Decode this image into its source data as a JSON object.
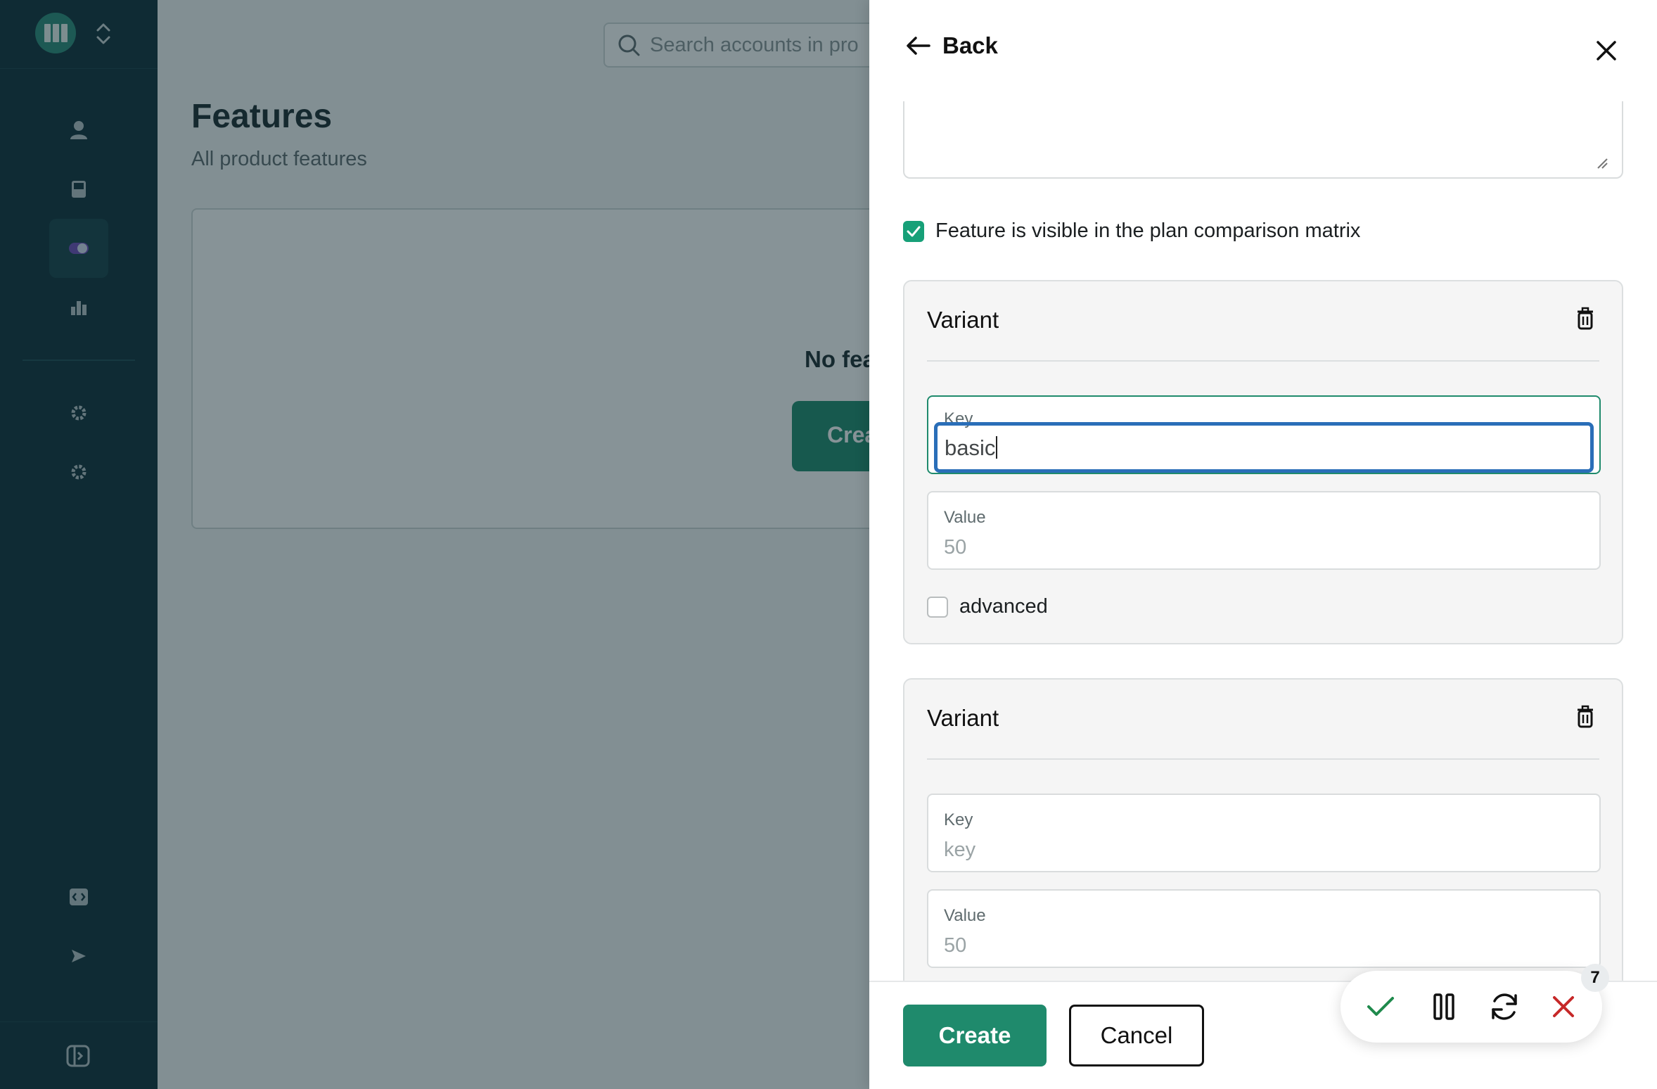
{
  "sidebar": {
    "logo_icon": "app-logo-icon",
    "items": [
      {
        "icon": "user-icon"
      },
      {
        "icon": "tablet-icon"
      },
      {
        "icon": "toggle-icon",
        "active": true
      },
      {
        "icon": "bar-chart-icon"
      },
      {
        "icon": "gear-icon"
      },
      {
        "icon": "gear-icon"
      }
    ],
    "bottom_items": [
      {
        "icon": "code-icon"
      },
      {
        "icon": "send-icon"
      }
    ],
    "collapse_icon": "sidebar-toggle-icon"
  },
  "main": {
    "search_placeholder": "Search accounts in pro",
    "title": "Features",
    "subtitle": "All product features",
    "empty_text": "No fea",
    "empty_button": "Crea"
  },
  "drawer": {
    "back_label": "Back",
    "visible_checkbox": {
      "label": "Feature is visible in the plan comparison matrix",
      "checked": true
    },
    "variants": [
      {
        "title": "Variant",
        "key": {
          "label": "Key",
          "value": "basic"
        },
        "value": {
          "label": "Value",
          "placeholder": "50"
        },
        "advanced": {
          "label": "advanced",
          "checked": false
        }
      },
      {
        "title": "Variant",
        "key": {
          "label": "Key",
          "placeholder": "key"
        },
        "value": {
          "label": "Value",
          "placeholder": "50"
        }
      }
    ],
    "create_label": "Create",
    "cancel_label": "Cancel"
  },
  "action_pill": {
    "badge": "7",
    "colors": {
      "confirm": "#1f8a4c",
      "reject": "#c62828"
    }
  },
  "colors": {
    "sidebar": "#0f2f38",
    "accent": "#1f8a6c",
    "focus": "#2a6eb8"
  }
}
